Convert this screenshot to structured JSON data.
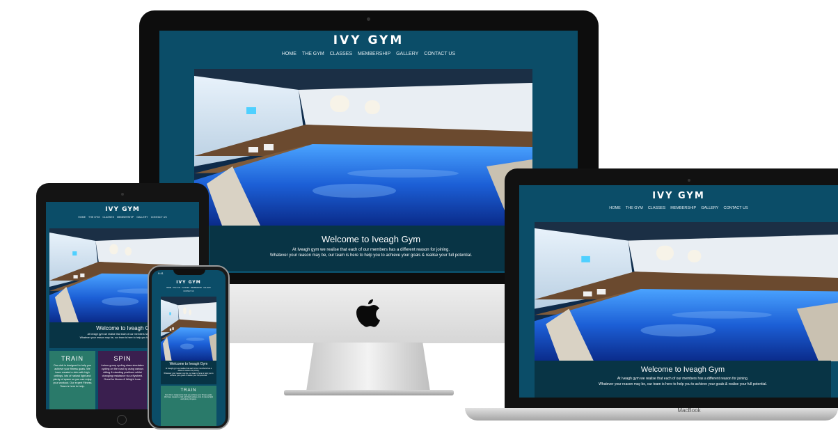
{
  "site": {
    "logo": "IVY GYM",
    "nav": [
      "HOME",
      "THE GYM",
      "CLASSES",
      "MEMBERSHIP",
      "GALLERY",
      "CONTACT US"
    ],
    "welcome_title": "Welcome to Iveagh Gym",
    "welcome_line1": "At Iveagh gym we realise that each of our members has a different reason for joining.",
    "welcome_line2": "Whatever your reason may be, our team is here to help you to achieve your goals & realise your full potential."
  },
  "tablet": {
    "welcome_title": "Welcome to Iveagh Gy",
    "welcome_line1": "At Iveagh gym we realise that each of our members has a different",
    "welcome_line2": "Whatever your reason may be, our team is here to help you to achieve your goal",
    "cards": [
      {
        "title": "TRAIN",
        "text": "Our club is designed to help you achieve your fitness goals. We have created a club with high ceilings, lots of natural light and plenty of space so you can enjoy your workout. Our expert Fitness Team is here to help."
      },
      {
        "title": "SPIN",
        "text": "Indoor group cycling class simulates cycling on the road by using various sitting & standing positions whilst changing resistance via a flywheel. Great for fitness & Weight Loss."
      }
    ]
  },
  "phone": {
    "time": "9:41",
    "nav": [
      "HOME",
      "THE GYM",
      "CLASSES",
      "MEMBERSHIP",
      "GALLERY",
      "CONTACT US"
    ],
    "welcome_title": "Welcome to Iveagh Gym",
    "welcome_line1": "At Iveagh gym we realise that each of our members has a different reason for joining.",
    "welcome_line2": "Whatever your reason may be, our team is here to help you to achieve your goals & realise your full potential.",
    "card_title": "TRAIN",
    "card_text": "Our club is designed to help you achieve your fitness goals. We have created a club with high ceilings, lots of natural light and plenty of space."
  },
  "laptop": {
    "brand": "MacBook"
  },
  "colors": {
    "page_bg": "#0b4d68",
    "welcome_bg": "#083445",
    "pool_water": "#1d6fe0",
    "train_card": "#2a7a6a",
    "spin_card": "#3a1f4f"
  }
}
